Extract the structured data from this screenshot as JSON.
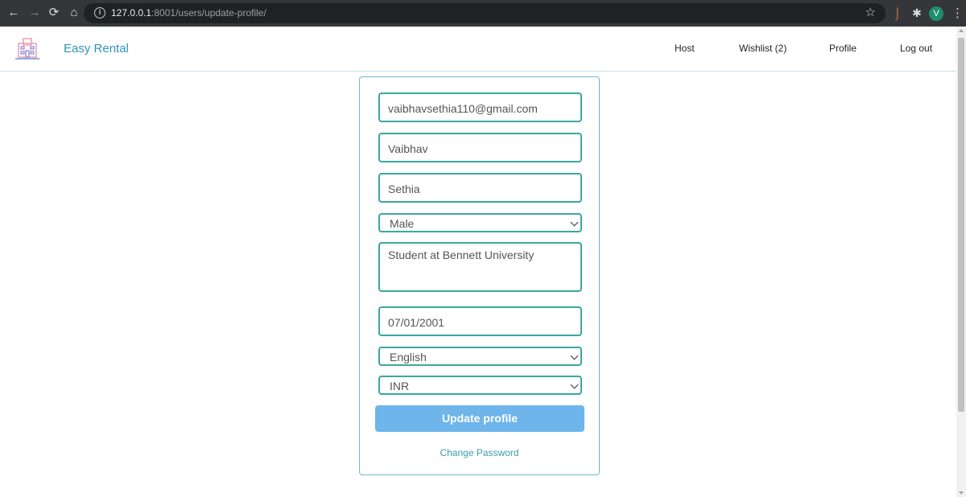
{
  "browser": {
    "url_host": "127.0.0.1",
    "url_path": ":8001/users/update-profile/",
    "profile_initial": "V"
  },
  "header": {
    "brand": "Easy Rental",
    "nav": [
      "Host",
      "Wishlist (2)",
      "Profile",
      "Log out"
    ]
  },
  "form": {
    "email": "vaibhavsethia110@gmail.com",
    "first_name": "Vaibhav",
    "last_name": "Sethia",
    "gender": "Male",
    "bio": "Student at Bennett University",
    "birthdate": "07/01/2001",
    "language": "English",
    "currency": "INR",
    "submit_label": "Update profile",
    "change_password_label": "Change Password"
  },
  "colors": {
    "brand": "#2f93b8",
    "field_border": "#3aa7a0",
    "button": "#6db5ea"
  }
}
